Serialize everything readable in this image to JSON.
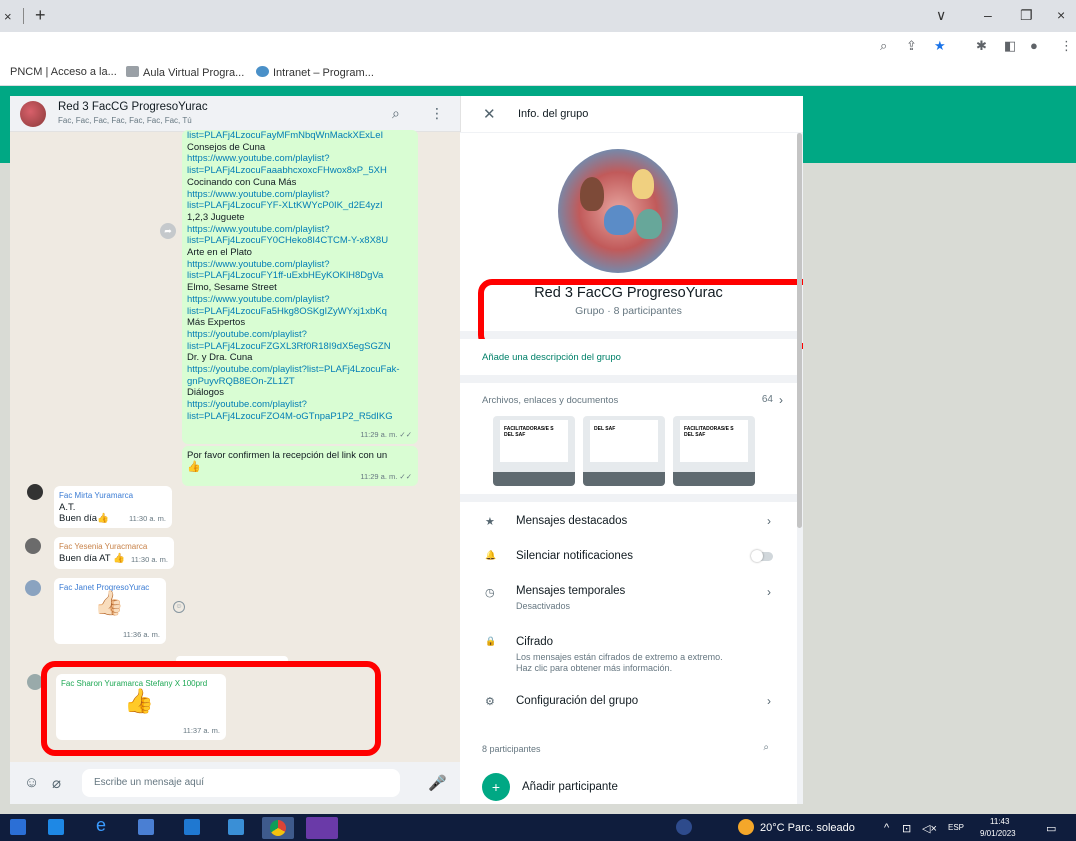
{
  "browser": {
    "tab_close": "×",
    "new_tab": "+",
    "window_controls": [
      "∨",
      "–",
      "❐",
      "×"
    ],
    "bookmarks": [
      "PNCM | Acceso a la...",
      "Aula Virtual Progra...",
      "Intranet – Program..."
    ]
  },
  "chat": {
    "name": "Red 3 FacCG ProgresoYurac",
    "members": "Fac, Fac, Fac, Fac, Fac, Fac, Fac, Tú",
    "long_message": [
      {
        "kind": "link",
        "text": "list=PLAFj4LzocuFayMFmNbqWnMackXExLeI"
      },
      {
        "kind": "text",
        "text": "Consejos de Cuna"
      },
      {
        "kind": "link",
        "text": "https://www.youtube.com/playlist?"
      },
      {
        "kind": "link",
        "text": "list=PLAFj4LzocuFaaabhcxoxcFHwox8xP_5XH"
      },
      {
        "kind": "text",
        "text": "Cocinando con Cuna Más"
      },
      {
        "kind": "link",
        "text": "https://www.youtube.com/playlist?"
      },
      {
        "kind": "link",
        "text": "list=PLAFj4LzocuFYF-XLtKWYcP0IK_d2E4yzI"
      },
      {
        "kind": "text",
        "text": "1,2,3 Juguete"
      },
      {
        "kind": "link",
        "text": "https://www.youtube.com/playlist?"
      },
      {
        "kind": "link",
        "text": "list=PLAFj4LzocuFY0CHeko8I4CTCM-Y-x8X8U"
      },
      {
        "kind": "text",
        "text": "Arte en el Plato"
      },
      {
        "kind": "link",
        "text": "https://www.youtube.com/playlist?"
      },
      {
        "kind": "link",
        "text": "list=PLAFj4LzocuFY1ff-uExbHEyKOKlH8DgVa"
      },
      {
        "kind": "text",
        "text": "Elmo, Sesame Street"
      },
      {
        "kind": "link",
        "text": "https://www.youtube.com/playlist?"
      },
      {
        "kind": "link",
        "text": "list=PLAFj4LzocuFa5Hkg8OSKgIZyWYxj1xbKq"
      },
      {
        "kind": "text",
        "text": "Más Expertos"
      },
      {
        "kind": "link",
        "text": "https://youtube.com/playlist?"
      },
      {
        "kind": "link",
        "text": "list=PLAFj4LzocuFZGXL3Rf0R18I9dX5egSGZN"
      },
      {
        "kind": "text",
        "text": "Dr. y Dra. Cuna"
      },
      {
        "kind": "link",
        "text": "https://youtube.com/playlist?list=PLAFj4LzocuFak-"
      },
      {
        "kind": "link",
        "text": "gnPuyvRQB8EOn-ZL1ZT"
      },
      {
        "kind": "text",
        "text": "Diálogos"
      },
      {
        "kind": "link",
        "text": "https://youtube.com/playlist?"
      },
      {
        "kind": "link",
        "text": "list=PLAFj4LzocuFZO4M-oGTnpaP1P2_R5dIKG"
      }
    ],
    "long_message_time": "11:29 a. m. ✓✓",
    "confirm_message": "Por favor confirmen la recepción del link con un",
    "confirm_emoji": "👍",
    "confirm_time": "11:29 a. m. ✓✓",
    "messages": [
      {
        "sender": "Fac Mirta Yuramarca",
        "line1": "A.T.",
        "line2": "Buen día👍",
        "time": "11:30 a. m."
      },
      {
        "sender": "Fac Yesenia Yuracmarca",
        "line1": "Buen día AT 👍",
        "time": "11:30 a. m."
      },
      {
        "sender": "Fac Janet ProgresoYurac",
        "emoji": "👍🏻",
        "time": "11:36 a. m."
      },
      {
        "sender": "Fac Sharon Yuramarca Stefany X 100prd",
        "emoji": "👍",
        "time": "11:37 a. m."
      }
    ],
    "composer_placeholder": "Escribe un mensaje aquí"
  },
  "info": {
    "title": "Info. del grupo",
    "group_name": "Red 3 FacCG ProgresoYurac",
    "group_sub": "Grupo · 8 participantes",
    "add_description": "Añade una descripción del grupo",
    "files_label": "Archivos, enlaces y documentos",
    "files_count": "64",
    "file_thumbs": [
      "FACILITADORAS/E S DEL SAF",
      "DEL SAF",
      "FACILITADORAS/E S DEL SAF"
    ],
    "rows": [
      {
        "icon": "★",
        "label": "Mensajes destacados"
      },
      {
        "icon": "🔔",
        "label": "Silenciar notificaciones"
      },
      {
        "icon": "◷",
        "label": "Mensajes temporales",
        "sub": "Desactivados"
      },
      {
        "icon": "🔒",
        "label": "Cifrado",
        "sub1": "Los mensajes están cifrados de extremo a extremo.",
        "sub2": "Haz clic para obtener más información."
      },
      {
        "icon": "⚙",
        "label": "Configuración del grupo"
      }
    ],
    "participants_label": "8 participantes",
    "add_participant": "Añadir participante"
  },
  "taskbar": {
    "weather": "20°C  Parc. soleado",
    "lang": "ESP",
    "time": "11:43",
    "date": "9/01/2023"
  }
}
